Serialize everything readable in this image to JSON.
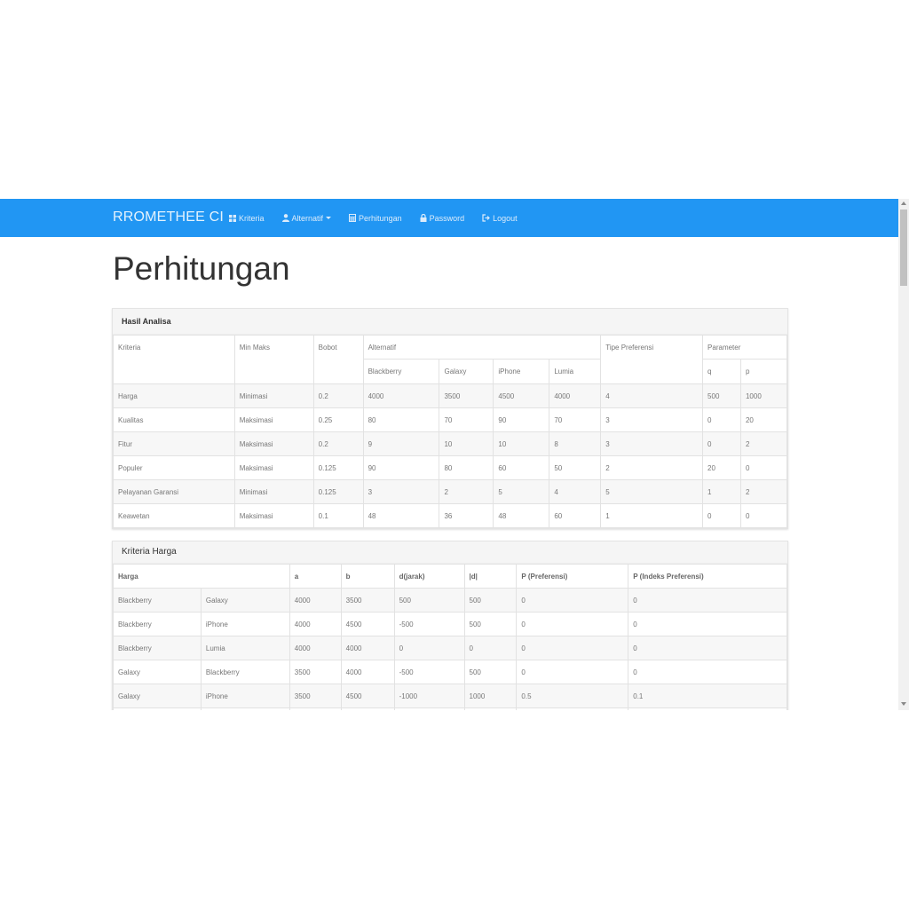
{
  "navbar": {
    "brand": "RROMETHEE CI",
    "items": [
      {
        "label": "Kriteria",
        "icon": "grid-icon"
      },
      {
        "label": "Alternatif",
        "icon": "user-icon",
        "dropdown": true
      },
      {
        "label": "Perhitungan",
        "icon": "calculator-icon"
      },
      {
        "label": "Password",
        "icon": "lock-icon"
      },
      {
        "label": "Logout",
        "icon": "logout-icon"
      }
    ]
  },
  "page_title": "Perhitungan",
  "hasil": {
    "heading": "Hasil Analisa",
    "headers": {
      "kriteria": "Kriteria",
      "min_maks": "Min Maks",
      "bobot": "Bobot",
      "alternatif": "Alternatif",
      "tipe": "Tipe Preferensi",
      "parameter": "Parameter",
      "alternatives": [
        "Blackberry",
        "Galaxy",
        "iPhone",
        "Lumia"
      ],
      "params": [
        "q",
        "p"
      ]
    },
    "rows": [
      [
        "Harga",
        "Minimasi",
        "0.2",
        "4000",
        "3500",
        "4500",
        "4000",
        "4",
        "500",
        "1000"
      ],
      [
        "Kualitas",
        "Maksimasi",
        "0.25",
        "80",
        "70",
        "90",
        "70",
        "3",
        "0",
        "20"
      ],
      [
        "Fitur",
        "Maksimasi",
        "0.2",
        "9",
        "10",
        "10",
        "8",
        "3",
        "0",
        "2"
      ],
      [
        "Populer",
        "Maksimasi",
        "0.125",
        "90",
        "80",
        "60",
        "50",
        "2",
        "20",
        "0"
      ],
      [
        "Pelayanan Garansi",
        "Minimasi",
        "0.125",
        "3",
        "2",
        "5",
        "4",
        "5",
        "1",
        "2"
      ],
      [
        "Keawetan",
        "Maksimasi",
        "0.1",
        "48",
        "36",
        "48",
        "60",
        "1",
        "0",
        "0"
      ]
    ]
  },
  "harga": {
    "heading": "Kriteria Harga",
    "headers": [
      "Harga",
      "a",
      "b",
      "d(jarak)",
      "|d|",
      "P (Preferensi)",
      "P (Indeks Preferensi)"
    ],
    "rows": [
      [
        "Blackberry",
        "Galaxy",
        "4000",
        "3500",
        "500",
        "500",
        "0",
        "0"
      ],
      [
        "Blackberry",
        "iPhone",
        "4000",
        "4500",
        "-500",
        "500",
        "0",
        "0"
      ],
      [
        "Blackberry",
        "Lumia",
        "4000",
        "4000",
        "0",
        "0",
        "0",
        "0"
      ],
      [
        "Galaxy",
        "Blackberry",
        "3500",
        "4000",
        "-500",
        "500",
        "0",
        "0"
      ],
      [
        "Galaxy",
        "iPhone",
        "3500",
        "4500",
        "-1000",
        "1000",
        "0.5",
        "0.1"
      ],
      [
        "",
        "",
        "",
        "",
        "",
        "",
        "",
        ""
      ]
    ]
  },
  "colors": {
    "navbar": "#2196f3",
    "page_bg": "#ffffff"
  }
}
